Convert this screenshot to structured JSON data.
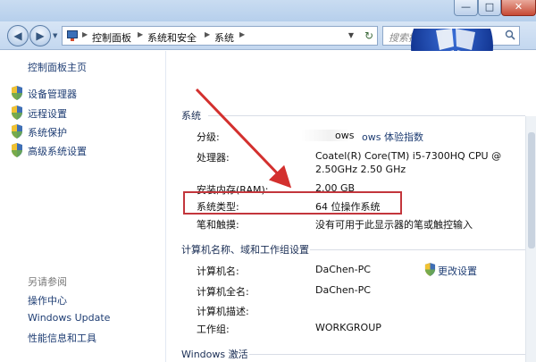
{
  "window": {
    "title": "",
    "buttons": {
      "minimize": "—",
      "maximize": "□",
      "close": "✕"
    }
  },
  "nav": {
    "back_icon": "◀",
    "forward_icon": "▶",
    "breadcrumbs": [
      "控制面板",
      "系统和安全",
      "系统"
    ],
    "search_placeholder": "搜索控制面板",
    "refresh_icon": "↻"
  },
  "sidebar": {
    "home": "控制面板主页",
    "items": [
      {
        "label": "设备管理器",
        "icon": "uac-shield-icon"
      },
      {
        "label": "远程设置",
        "icon": "uac-shield-icon"
      },
      {
        "label": "系统保护",
        "icon": "uac-shield-icon"
      },
      {
        "label": "高级系统设置",
        "icon": "uac-shield-icon"
      }
    ],
    "see_also": "另请参阅",
    "see_also_links": [
      "操作中心",
      "Windows Update",
      "性能信息和工具"
    ]
  },
  "system": {
    "heading": "系统",
    "rows": [
      {
        "label": "分级:",
        "value": "ows 体验指数",
        "value_prefix": "ows"
      },
      {
        "label": "处理器:",
        "value": "Coatel(R) Core(TM) i5-7300HQ CPU @",
        "value2": "2.50GHz   2.50 GHz"
      },
      {
        "label": "安装内存(RAM):",
        "value": "2.00 GB"
      },
      {
        "label": "系统类型:",
        "value": "64 位操作系统"
      },
      {
        "label": "笔和触摸:",
        "value": "没有可用于此显示器的笔或触控输入"
      }
    ]
  },
  "computer": {
    "heading": "计算机名称、域和工作组设置",
    "change_settings": "更改设置",
    "rows": [
      {
        "label": "计算机名:",
        "value": "DaChen-PC"
      },
      {
        "label": "计算机全名:",
        "value": "DaChen-PC"
      },
      {
        "label": "计算机描述:",
        "value": ""
      },
      {
        "label": "工作组:",
        "value": "WORKGROUP"
      }
    ]
  },
  "activation": {
    "heading": "Windows 激活"
  },
  "colors": {
    "link": "#1e3d73",
    "highlight": "#c3363c",
    "arrow": "#d3302e"
  }
}
